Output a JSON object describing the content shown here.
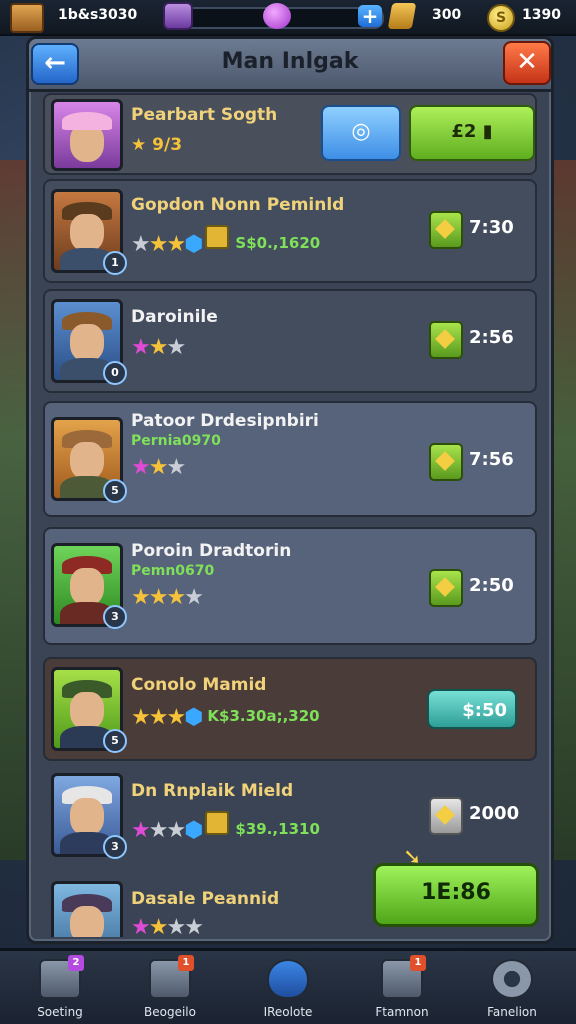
{
  "topbar": {
    "coins": "1b&s3030",
    "gems": "300",
    "gold": "1390",
    "gold_symbol": "S",
    "plus": "+"
  },
  "panel": {
    "title": "Man Inlgak",
    "back_label": "←",
    "close_label": "✕"
  },
  "featured": {
    "name": "Pearbart Sogth",
    "rating": "★ 9/3",
    "blue_button": "◎",
    "green_button": "£2 ▮"
  },
  "rows": [
    {
      "name": "Gopdon Nonn Peminld",
      "level": "1",
      "stars": [
        "silver",
        "gold",
        "gold",
        "gem"
      ],
      "cash": "S$0.,1620",
      "price": "7:30"
    },
    {
      "name": "Daroinile",
      "level": "0",
      "stars": [
        "pink",
        "gold",
        "silver"
      ],
      "price": "2:56"
    },
    {
      "name": "Patoor Drdesipnbiri",
      "subtext": "Pernia0970",
      "level": "5",
      "stars": [
        "pink",
        "gold",
        "silver"
      ],
      "price": "7:56"
    },
    {
      "name": "Poroin Dradtorin",
      "subtext": "Pemn0670",
      "level": "3",
      "stars": [
        "gold",
        "gold",
        "gold",
        "silver"
      ],
      "price": "2:50"
    },
    {
      "name": "Conolo Mamid",
      "level": "5",
      "stars": [
        "gold",
        "gold",
        "gold",
        "gem"
      ],
      "cash": "K$3.30a;,320",
      "button": "$:50"
    },
    {
      "name": "Dn Rnplaik Mield",
      "level": "3",
      "stars": [
        "pink",
        "silver",
        "silver",
        "gem"
      ],
      "cash": "$39.,1310",
      "price": "2000"
    },
    {
      "name": "Dasale Peannid",
      "stars": [
        "pink",
        "gold",
        "silver",
        "silver"
      ]
    }
  ],
  "cta": {
    "label": "1E:86"
  },
  "nav": [
    {
      "label": "Soeting",
      "badge": "2"
    },
    {
      "label": "Beogeilo",
      "badge": "1"
    },
    {
      "label": "IReolote"
    },
    {
      "label": "Ftamnon",
      "badge": "1"
    },
    {
      "label": "Fanelion"
    }
  ],
  "colors": {
    "accent_green": "#7fe05a",
    "name_gold": "#f0d27a",
    "star_gold": "#f6c23a",
    "panel_bg": "#3b4454"
  }
}
